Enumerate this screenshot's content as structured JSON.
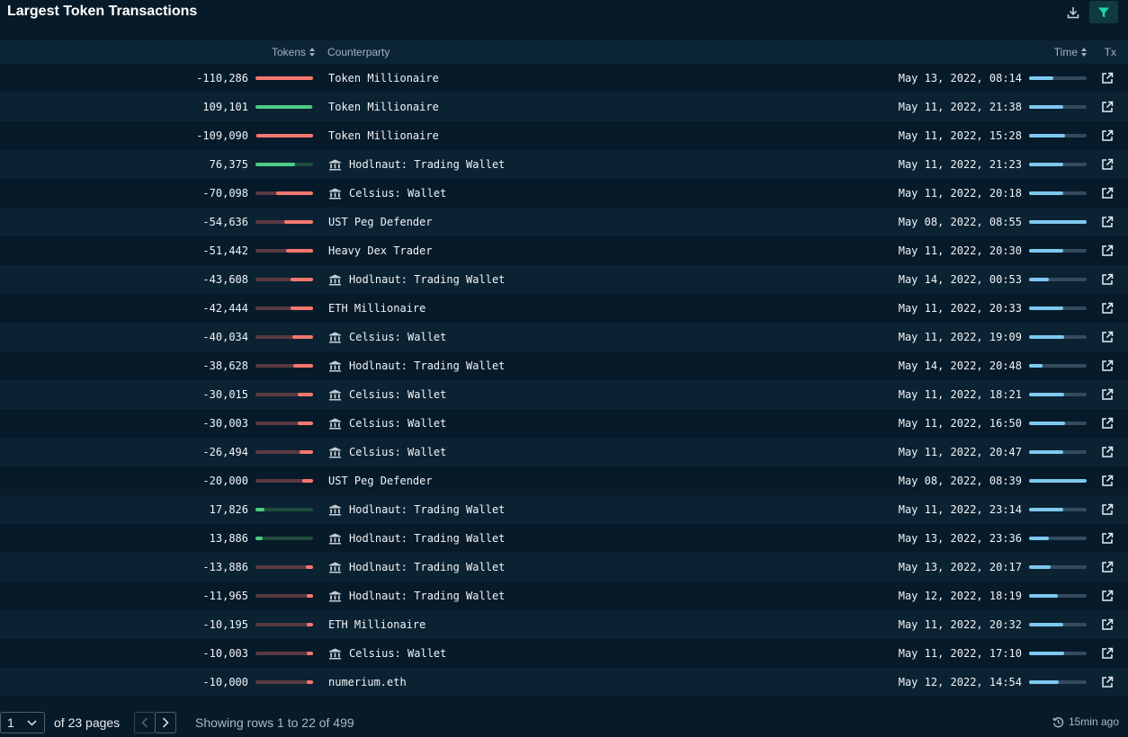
{
  "title": "Largest Token Transactions",
  "colors": {
    "positive": "#4ecb85",
    "negative": "#f5776e",
    "positive_track": "#1e4b3d",
    "negative_track": "#5a3942",
    "time_bar": "#7ec8f0",
    "accent": "#19d9a5"
  },
  "columns": {
    "tokens": "Tokens",
    "counterparty": "Counterparty",
    "time": "Time",
    "tx": "Tx"
  },
  "rows": [
    {
      "amount": "-110,286",
      "value": -110286,
      "counterparty": "Token Millionaire",
      "icon": "",
      "time": "May 13, 2022, 08:14",
      "time_frac": 0.42
    },
    {
      "amount": "109,101",
      "value": 109101,
      "counterparty": "Token Millionaire",
      "icon": "",
      "time": "May 11, 2022, 21:38",
      "time_frac": 0.6
    },
    {
      "amount": "-109,090",
      "value": -109090,
      "counterparty": "Token Millionaire",
      "icon": "",
      "time": "May 11, 2022, 15:28",
      "time_frac": 0.62
    },
    {
      "amount": "76,375",
      "value": 76375,
      "counterparty": "Hodlnaut: Trading Wallet",
      "icon": "bank-icon",
      "time": "May 11, 2022, 21:23",
      "time_frac": 0.6
    },
    {
      "amount": "-70,098",
      "value": -70098,
      "counterparty": "Celsius: Wallet",
      "icon": "bank-icon",
      "time": "May 11, 2022, 20:18",
      "time_frac": 0.6
    },
    {
      "amount": "-54,636",
      "value": -54636,
      "counterparty": "UST Peg Defender",
      "icon": "",
      "time": "May 08, 2022, 08:55",
      "time_frac": 1.0
    },
    {
      "amount": "-51,442",
      "value": -51442,
      "counterparty": "Heavy Dex Trader",
      "icon": "",
      "time": "May 11, 2022, 20:30",
      "time_frac": 0.6
    },
    {
      "amount": "-43,608",
      "value": -43608,
      "counterparty": "Hodlnaut: Trading Wallet",
      "icon": "bank-icon",
      "time": "May 14, 2022, 00:53",
      "time_frac": 0.34
    },
    {
      "amount": "-42,444",
      "value": -42444,
      "counterparty": "ETH Millionaire",
      "icon": "",
      "time": "May 11, 2022, 20:33",
      "time_frac": 0.6
    },
    {
      "amount": "-40,034",
      "value": -40034,
      "counterparty": "Celsius: Wallet",
      "icon": "bank-icon",
      "time": "May 11, 2022, 19:09",
      "time_frac": 0.61
    },
    {
      "amount": "-38,628",
      "value": -38628,
      "counterparty": "Hodlnaut: Trading Wallet",
      "icon": "bank-icon",
      "time": "May 14, 2022, 20:48",
      "time_frac": 0.24
    },
    {
      "amount": "-30,015",
      "value": -30015,
      "counterparty": "Celsius: Wallet",
      "icon": "bank-icon",
      "time": "May 11, 2022, 18:21",
      "time_frac": 0.61
    },
    {
      "amount": "-30,003",
      "value": -30003,
      "counterparty": "Celsius: Wallet",
      "icon": "bank-icon",
      "time": "May 11, 2022, 16:50",
      "time_frac": 0.62
    },
    {
      "amount": "-26,494",
      "value": -26494,
      "counterparty": "Celsius: Wallet",
      "icon": "bank-icon",
      "time": "May 11, 2022, 20:47",
      "time_frac": 0.6
    },
    {
      "amount": "-20,000",
      "value": -20000,
      "counterparty": "UST Peg Defender",
      "icon": "",
      "time": "May 08, 2022, 08:39",
      "time_frac": 1.0
    },
    {
      "amount": "17,826",
      "value": 17826,
      "counterparty": "Hodlnaut: Trading Wallet",
      "icon": "bank-icon",
      "time": "May 11, 2022, 23:14",
      "time_frac": 0.6
    },
    {
      "amount": "13,886",
      "value": 13886,
      "counterparty": "Hodlnaut: Trading Wallet",
      "icon": "bank-icon",
      "time": "May 13, 2022, 23:36",
      "time_frac": 0.35
    },
    {
      "amount": "-13,886",
      "value": -13886,
      "counterparty": "Hodlnaut: Trading Wallet",
      "icon": "bank-icon",
      "time": "May 13, 2022, 20:17",
      "time_frac": 0.37
    },
    {
      "amount": "-11,965",
      "value": -11965,
      "counterparty": "Hodlnaut: Trading Wallet",
      "icon": "bank-icon",
      "time": "May 12, 2022, 18:19",
      "time_frac": 0.5
    },
    {
      "amount": "-10,195",
      "value": -10195,
      "counterparty": "ETH Millionaire",
      "icon": "",
      "time": "May 11, 2022, 20:32",
      "time_frac": 0.6
    },
    {
      "amount": "-10,003",
      "value": -10003,
      "counterparty": "Celsius: Wallet",
      "icon": "bank-icon",
      "time": "May 11, 2022, 17:10",
      "time_frac": 0.61
    },
    {
      "amount": "-10,000",
      "value": -10000,
      "counterparty": "numerium.eth",
      "icon": "",
      "time": "May 12, 2022, 14:54",
      "time_frac": 0.51
    }
  ],
  "footer": {
    "page_value": "1",
    "of_pages": "of 23 pages",
    "showing": "Showing rows 1 to 22 of 499",
    "updated": "15min ago"
  }
}
